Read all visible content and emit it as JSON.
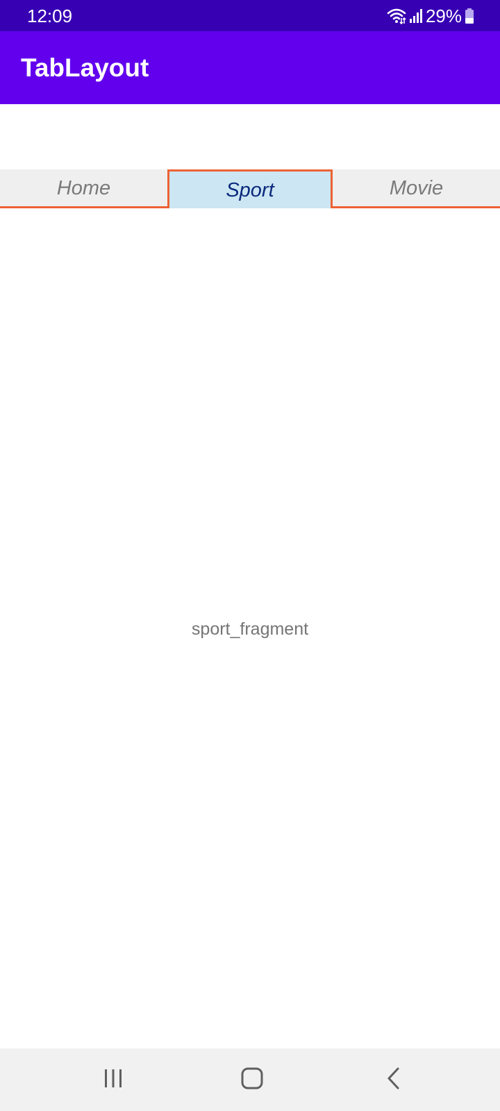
{
  "status_bar": {
    "time": "12:09",
    "battery_percent": "29%",
    "icons": [
      "wifi-icon",
      "signal-icon",
      "battery-icon"
    ]
  },
  "app_bar": {
    "title": "TabLayout"
  },
  "tabs": [
    {
      "label": "Home",
      "selected": false
    },
    {
      "label": "Sport",
      "selected": true
    },
    {
      "label": "Movie",
      "selected": false
    }
  ],
  "content": {
    "text": "sport_fragment"
  },
  "nav_bar": {
    "icons": [
      "recent-apps-icon",
      "home-icon",
      "back-icon"
    ]
  },
  "colors": {
    "status_bar": "#3700b3",
    "app_bar": "#6200ee",
    "tab_background": "#efefef",
    "selected_tab_background": "#cce6f3",
    "tab_indicator": "#ee6133",
    "selected_tab_text": "#0b2a7c"
  }
}
